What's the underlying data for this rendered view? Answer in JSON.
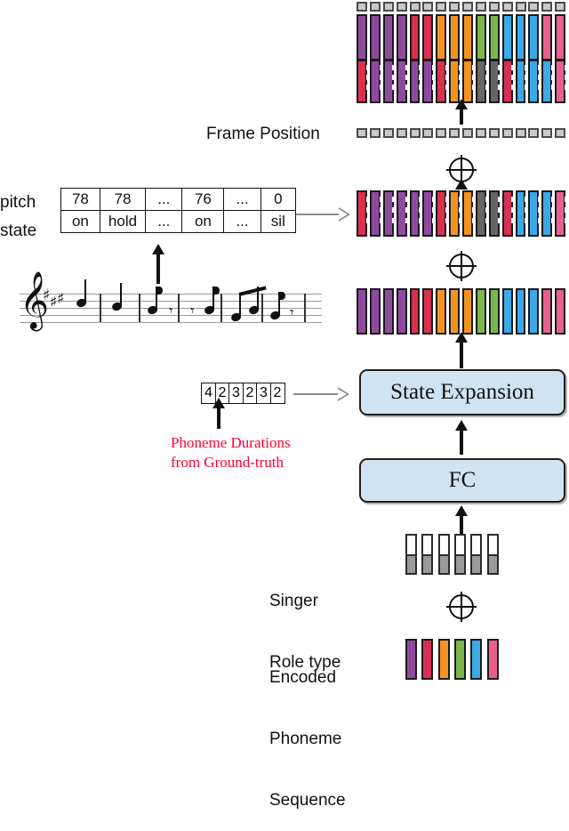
{
  "palette": {
    "purple": "#8e4b9e",
    "crimson": "#d8304f",
    "orange": "#f39422",
    "green": "#7ab648",
    "blue": "#3ba9e8",
    "pink": "#e8608f",
    "gray": "#666666",
    "box_fill": "#cfe3f2",
    "red_text": "#ff0033",
    "frame_square": "#c9c9c9"
  },
  "labels": {
    "frame_position": "Frame Position",
    "pitch": "pitch",
    "state": "state",
    "singer_line1": "Singer",
    "singer_line2": "Role type",
    "encoded_line1": "Encoded",
    "encoded_line2": "Phoneme",
    "encoded_line3": "Sequence",
    "duration_note_line1": "Phoneme Durations",
    "duration_note_line2": "from Ground-truth"
  },
  "blocks": {
    "state_expansion": "State Expansion",
    "fc": "FC"
  },
  "score_table": {
    "row_labels": [
      "pitch",
      "state"
    ],
    "pitch": [
      "78",
      "78",
      "...",
      "76",
      "...",
      "0"
    ],
    "state": [
      "on",
      "hold",
      "...",
      "on",
      "...",
      "sil"
    ]
  },
  "durations": {
    "values": [
      "4",
      "2",
      "3",
      "2",
      "3",
      "2"
    ],
    "total_frames": 16
  },
  "phoneme_sequence": {
    "count": 6,
    "colors": [
      "purple",
      "crimson",
      "orange",
      "green",
      "blue",
      "pink"
    ]
  },
  "singer_role": {
    "count": 6,
    "top_color": "#ffffff",
    "bottom_color": "#9b9b9b"
  },
  "expanded_phonemes": {
    "count": 16,
    "colors": [
      "purple",
      "purple",
      "purple",
      "purple",
      "crimson",
      "crimson",
      "orange",
      "orange",
      "orange",
      "green",
      "green",
      "blue",
      "blue",
      "blue",
      "pink",
      "pink"
    ]
  },
  "pitch_state_expanded": {
    "count": 16,
    "colors": [
      "crimson",
      "purple",
      "purple",
      "purple",
      "purple",
      "purple",
      "crimson",
      "orange",
      "orange",
      "gray",
      "gray",
      "crimson",
      "blue",
      "blue",
      "blue",
      "pink"
    ]
  },
  "frame_position": {
    "count": 16
  },
  "final_stack": {
    "count": 16,
    "top_colors": [
      "purple",
      "purple",
      "purple",
      "purple",
      "crimson",
      "crimson",
      "orange",
      "orange",
      "orange",
      "green",
      "green",
      "blue",
      "blue",
      "blue",
      "pink",
      "pink"
    ],
    "bottom_colors": [
      "crimson",
      "purple",
      "purple",
      "purple",
      "purple",
      "purple",
      "crimson",
      "orange",
      "orange",
      "gray",
      "gray",
      "crimson",
      "blue",
      "blue",
      "blue",
      "pink"
    ]
  },
  "operators": {
    "plus": "⊕"
  },
  "score": {
    "key_sharps": 3,
    "clef": "treble"
  }
}
